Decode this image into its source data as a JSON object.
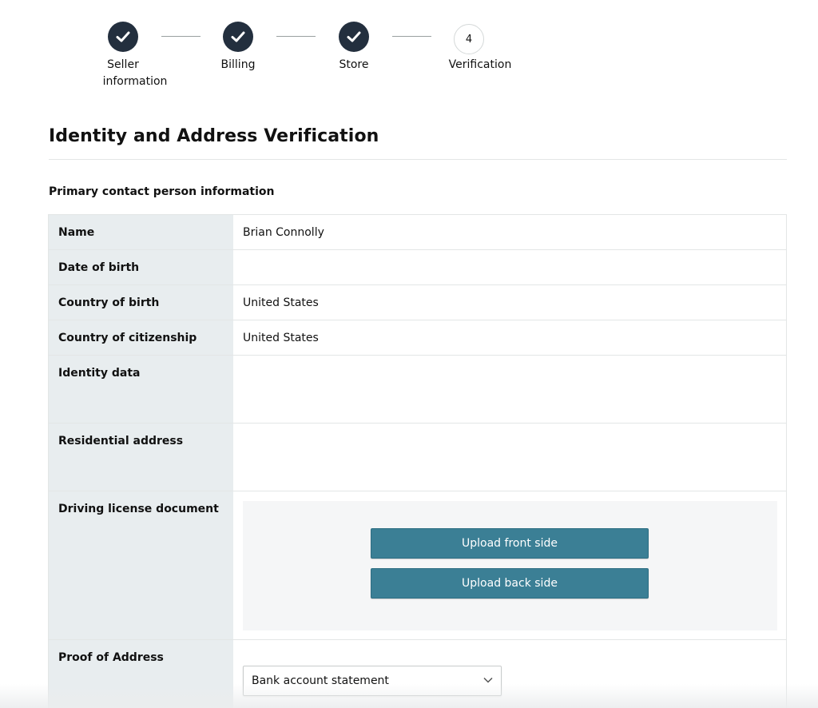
{
  "stepper": {
    "steps": [
      {
        "label_line1": "Seller",
        "label_line2": "information",
        "state": "complete",
        "icon": "checkmark-icon"
      },
      {
        "label_line1": "Billing",
        "label_line2": "",
        "state": "complete",
        "icon": "checkmark-icon"
      },
      {
        "label_line1": "Store",
        "label_line2": "",
        "state": "complete",
        "icon": "checkmark-icon"
      },
      {
        "label_line1": "Verification",
        "label_line2": "",
        "state": "current",
        "number": "4"
      }
    ]
  },
  "page": {
    "title": "Identity and Address Verification",
    "section_title": "Primary contact person information"
  },
  "table": {
    "rows": [
      {
        "label": "Name",
        "value": "Brian Connolly"
      },
      {
        "label": "Date of birth",
        "value": ""
      },
      {
        "label": "Country of birth",
        "value": "United States"
      },
      {
        "label": "Country of citizenship",
        "value": "United States"
      },
      {
        "label": "Identity data",
        "value": ""
      },
      {
        "label": "Residential address",
        "value": ""
      },
      {
        "label": "Driving license document",
        "value": ""
      },
      {
        "label": "Proof of Address",
        "value": ""
      }
    ]
  },
  "upload": {
    "front_label": "Upload front side",
    "back_label": "Upload back side"
  },
  "proof_of_address": {
    "selected": "Bank account statement"
  },
  "colors": {
    "step_done": "#232f3e",
    "label_bg": "#e8edef",
    "upload_button": "#3b7f95"
  }
}
